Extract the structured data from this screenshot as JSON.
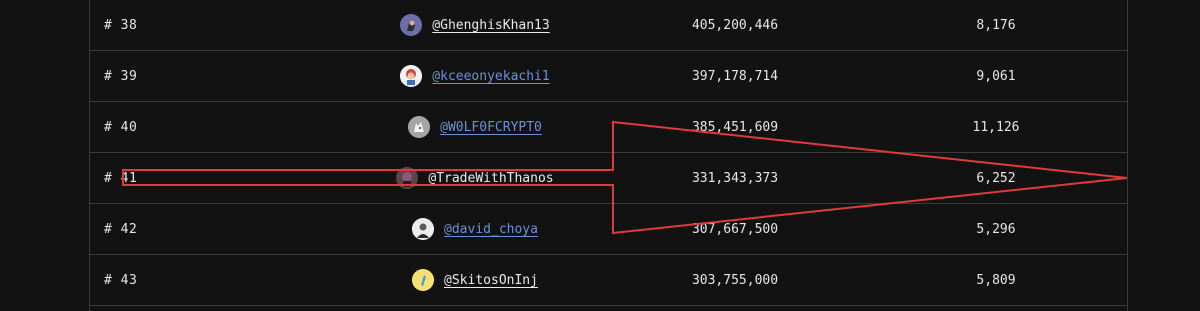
{
  "rows": [
    {
      "rank": "# 38",
      "handle": "@GhenghisKhan13",
      "handle_style": "white",
      "avatar": "avatar-warrior",
      "views": "405,200,446",
      "count": "8,176"
    },
    {
      "rank": "# 39",
      "handle": "@kceeonyekachi1",
      "handle_style": "blue",
      "avatar": "avatar-cartoon",
      "views": "397,178,714",
      "count": "9,061"
    },
    {
      "rank": "# 40",
      "handle": "@W0LF0FCRYPT0",
      "handle_style": "blue",
      "avatar": "avatar-wolf",
      "views": "385,451,609",
      "count": "11,126"
    },
    {
      "rank": "# 41",
      "handle": "@TradeWithThanos",
      "handle_style": "white",
      "avatar": "avatar-thanos",
      "views": "331,343,373",
      "count": "6,252"
    },
    {
      "rank": "# 42",
      "handle": "@david_choya",
      "handle_style": "blue",
      "avatar": "avatar-person",
      "views": "307,667,500",
      "count": "5,296"
    },
    {
      "rank": "# 43",
      "handle": "@SkitosOnInj",
      "handle_style": "white",
      "avatar": "avatar-yellow",
      "views": "303,755,000",
      "count": "5,809"
    }
  ],
  "colors": {
    "background": "#121212",
    "border": "#3a3a3a",
    "link_blue": "#6f8fd8",
    "arrow_red": "#e03a3a"
  }
}
